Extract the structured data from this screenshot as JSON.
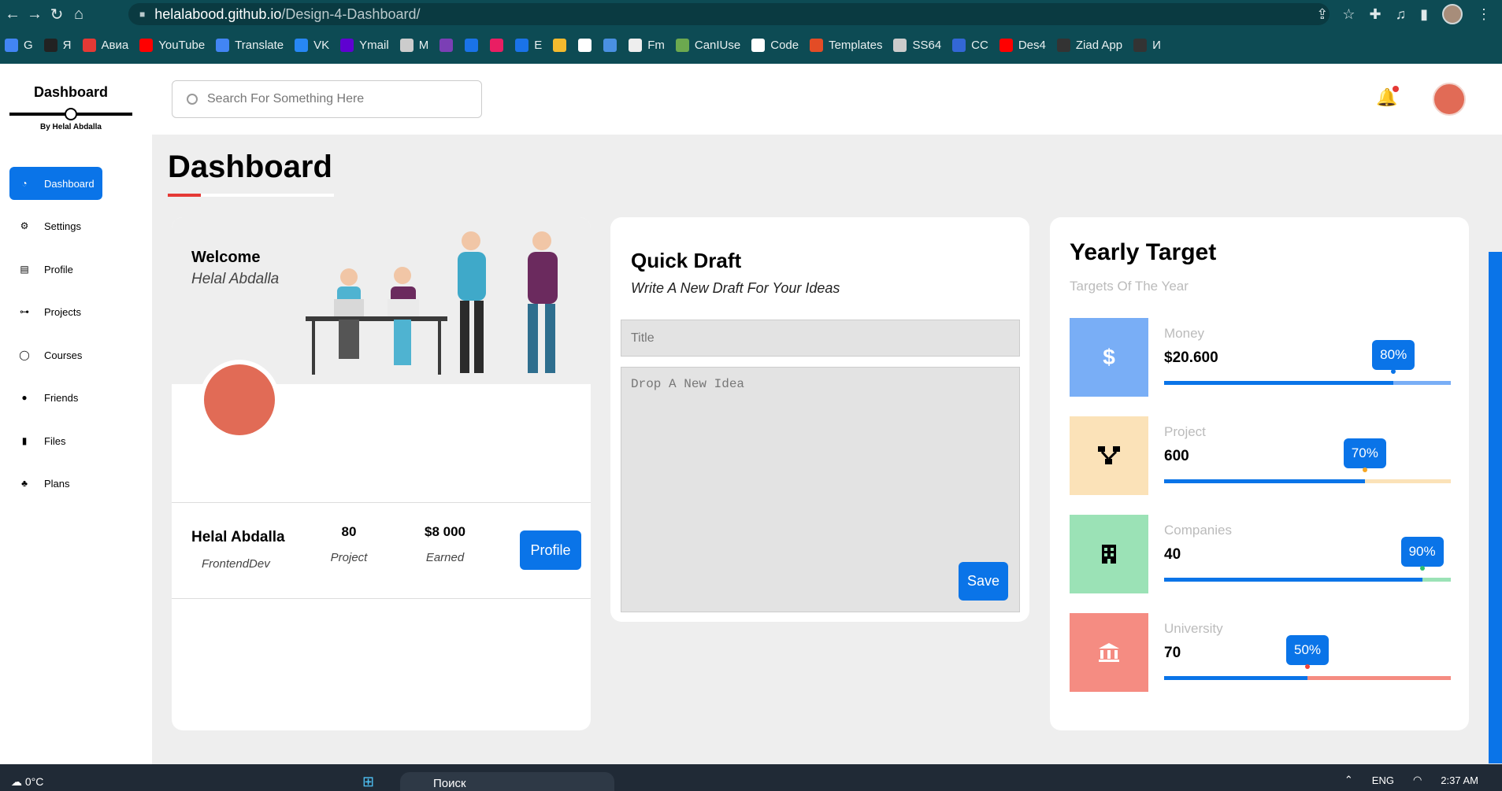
{
  "browser": {
    "url_host": "helalabood.github.io",
    "url_path": "/Design-4-Dashboard/",
    "bookmarks": [
      "G",
      "Я",
      "Авиа",
      "YouTube",
      "Translate",
      "VK",
      "Ymail",
      "M",
      "",
      "",
      "",
      "E",
      "",
      "",
      "",
      "Fm",
      "CanIUse",
      "Code",
      "Templates",
      "SS64",
      "CC",
      "Des4",
      "Ziad App",
      "И"
    ]
  },
  "sidebar": {
    "brand": "Dashboard",
    "brand_sub": "By Helal Abdalla",
    "items": [
      {
        "label": "Dashboard",
        "icon": "pie-chart-icon"
      },
      {
        "label": "Settings",
        "icon": "gears-icon"
      },
      {
        "label": "Profile",
        "icon": "id-card-icon"
      },
      {
        "label": "Projects",
        "icon": "diagram-icon"
      },
      {
        "label": "Courses",
        "icon": "chat-icon"
      },
      {
        "label": "Friends",
        "icon": "users-icon"
      },
      {
        "label": "Files",
        "icon": "file-icon"
      },
      {
        "label": "Plans",
        "icon": "plant-icon"
      }
    ]
  },
  "header": {
    "search_placeholder": "Search For Something Here"
  },
  "page": {
    "title": "Dashboard"
  },
  "welcome": {
    "title": "Welcome",
    "name": "Helal Abdalla",
    "user_name": "Helal Abdalla",
    "user_role": "FrontendDev",
    "stats": [
      {
        "value": "80",
        "label": "Project"
      },
      {
        "value": "$8 000",
        "label": "Earned"
      }
    ],
    "profile_button": "Profile"
  },
  "quick_draft": {
    "title": "Quick Draft",
    "subtitle": "Write A New Draft For Your Ideas",
    "title_placeholder": "Title",
    "idea_placeholder": "Drop A New Idea",
    "save_button": "Save"
  },
  "yearly_target": {
    "title": "Yearly Target",
    "subtitle": "Targets Of The Year",
    "targets": [
      {
        "label": "Money",
        "value": "$20.600",
        "percent_label": "80%",
        "percent": 80,
        "icon": "dollar-icon",
        "glyph": "$",
        "color": "#0a74e8",
        "bg": "#79aef6",
        "track": "#79aef6"
      },
      {
        "label": "Project",
        "value": "600",
        "percent_label": "70%",
        "percent": 70,
        "icon": "diagram-icon",
        "glyph": "",
        "color": "#f5a623",
        "bg": "#fbe2b8",
        "track": "#fbe2b8"
      },
      {
        "label": "Companies",
        "value": "40",
        "percent_label": "90%",
        "percent": 90,
        "icon": "building-icon",
        "glyph": "",
        "color": "#2fbf71",
        "bg": "#9be2b6",
        "track": "#9be2b6"
      },
      {
        "label": "University",
        "value": "70",
        "percent_label": "50%",
        "percent": 50,
        "icon": "university-icon",
        "glyph": "",
        "color": "#f44336",
        "bg": "#f58c82",
        "track": "#f58c82"
      }
    ]
  },
  "taskbar": {
    "weather": "0°C",
    "search": "Поиск",
    "lang": "ENG",
    "time": "2:37 AM"
  },
  "colors": {
    "accent": "#0a74e8",
    "chrome": "#0d4b54",
    "title_underline": "#e53935"
  }
}
